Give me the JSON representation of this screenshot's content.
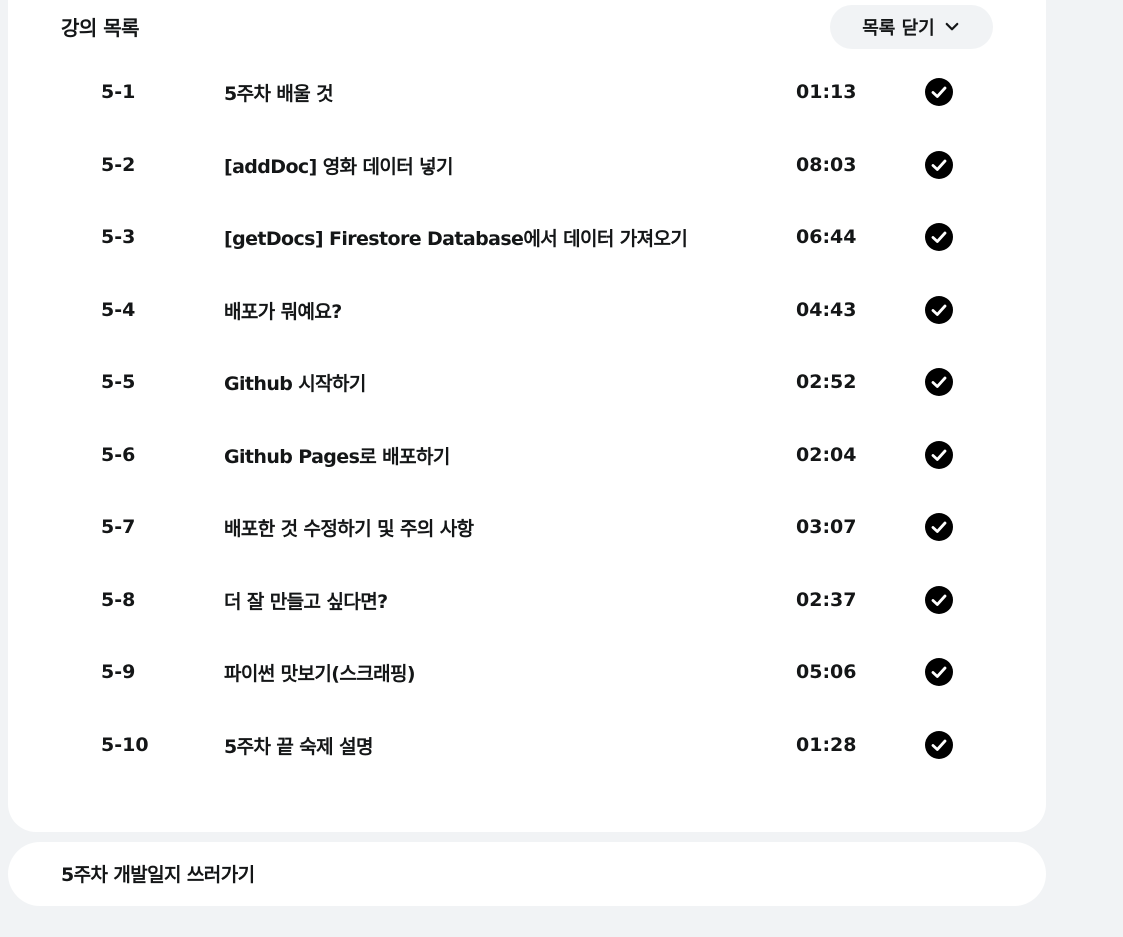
{
  "lecture_list": {
    "title": "강의 목록",
    "toggle_label": "목록 닫기",
    "items": [
      {
        "num": "5-1",
        "title": "5주차 배울 것",
        "duration": "01:13",
        "completed": true
      },
      {
        "num": "5-2",
        "title": "[addDoc] 영화 데이터 넣기",
        "duration": "08:03",
        "completed": true
      },
      {
        "num": "5-3",
        "title": "[getDocs] Firestore Database에서 데이터 가져오기",
        "duration": "06:44",
        "completed": true
      },
      {
        "num": "5-4",
        "title": "배포가 뭐예요?",
        "duration": "04:43",
        "completed": true
      },
      {
        "num": "5-5",
        "title": "Github 시작하기",
        "duration": "02:52",
        "completed": true
      },
      {
        "num": "5-6",
        "title": "Github Pages로 배포하기",
        "duration": "02:04",
        "completed": true
      },
      {
        "num": "5-7",
        "title": "배포한 것 수정하기 및 주의 사항",
        "duration": "03:07",
        "completed": true
      },
      {
        "num": "5-8",
        "title": "더 잘 만들고 싶다면?",
        "duration": "02:37",
        "completed": true
      },
      {
        "num": "5-9",
        "title": "파이썬 맛보기(스크래핑)",
        "duration": "05:06",
        "completed": true
      },
      {
        "num": "5-10",
        "title": "5주차 끝 숙제 설명",
        "duration": "01:28",
        "completed": true
      }
    ]
  },
  "journal": {
    "title": "5주차 개발일지 쓰러가기"
  },
  "colors": {
    "page_bg": "#f1f3f5",
    "card_bg": "#ffffff",
    "text": "#141617",
    "check_fill": "#000000"
  }
}
